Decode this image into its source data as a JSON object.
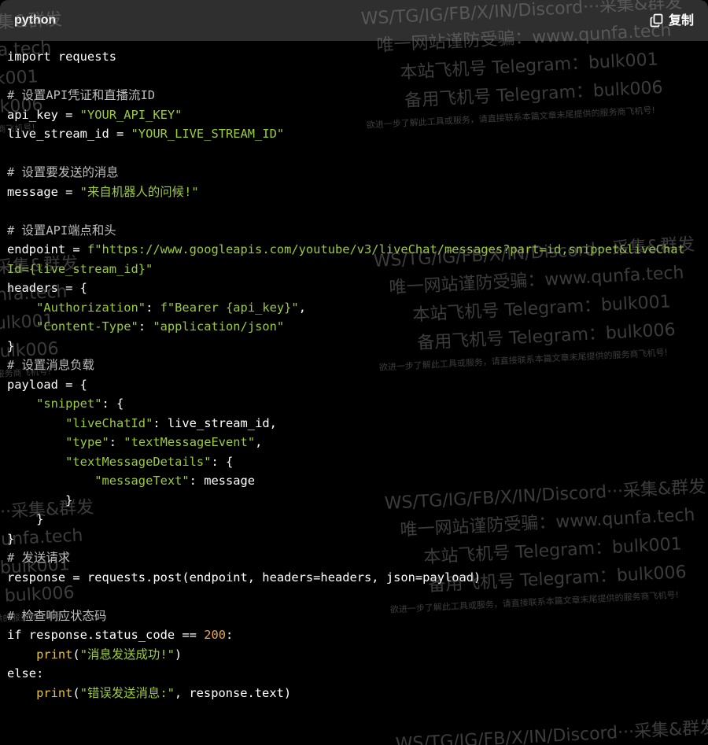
{
  "header": {
    "language": "python",
    "copy_label": "复制",
    "copy_icon": "copy-icon"
  },
  "code_lines": [
    [
      {
        "t": "import requests",
        "c": "kw"
      }
    ],
    [],
    [
      {
        "t": "# 设置API凭证和直播流ID",
        "c": "cm"
      }
    ],
    [
      {
        "t": "api_key = ",
        "c": "kw"
      },
      {
        "t": "\"YOUR_API_KEY\"",
        "c": "st"
      }
    ],
    [
      {
        "t": "live_stream_id = ",
        "c": "kw"
      },
      {
        "t": "\"YOUR_LIVE_STREAM_ID\"",
        "c": "st"
      }
    ],
    [],
    [
      {
        "t": "# 设置要发送的消息",
        "c": "cm"
      }
    ],
    [
      {
        "t": "message = ",
        "c": "kw"
      },
      {
        "t": "\"来自机器人的问候!\"",
        "c": "st"
      }
    ],
    [],
    [
      {
        "t": "# 设置API端点和头",
        "c": "cm"
      }
    ],
    [
      {
        "t": "endpoint = ",
        "c": "kw"
      },
      {
        "t": "f\"https://www.googleapis.com/youtube/v3/liveChat/messages?part=id,snippet&liveChat",
        "c": "st"
      }
    ],
    [
      {
        "t": "Id={live_stream_id}\"",
        "c": "st"
      }
    ],
    [
      {
        "t": "headers = {",
        "c": "kw"
      }
    ],
    [
      {
        "t": "    ",
        "c": "kw"
      },
      {
        "t": "\"Authorization\"",
        "c": "st"
      },
      {
        "t": ": ",
        "c": "kw"
      },
      {
        "t": "f\"Bearer {api_key}\"",
        "c": "st"
      },
      {
        "t": ",",
        "c": "kw"
      }
    ],
    [
      {
        "t": "    ",
        "c": "kw"
      },
      {
        "t": "\"Content-Type\"",
        "c": "st"
      },
      {
        "t": ": ",
        "c": "kw"
      },
      {
        "t": "\"application/json\"",
        "c": "st"
      }
    ],
    [
      {
        "t": "}",
        "c": "kw"
      }
    ],
    [
      {
        "t": "# 设置消息负载",
        "c": "cm"
      }
    ],
    [
      {
        "t": "payload = {",
        "c": "kw"
      }
    ],
    [
      {
        "t": "    ",
        "c": "kw"
      },
      {
        "t": "\"snippet\"",
        "c": "st"
      },
      {
        "t": ": {",
        "c": "kw"
      }
    ],
    [
      {
        "t": "        ",
        "c": "kw"
      },
      {
        "t": "\"liveChatId\"",
        "c": "st"
      },
      {
        "t": ": live_stream_id,",
        "c": "kw"
      }
    ],
    [
      {
        "t": "        ",
        "c": "kw"
      },
      {
        "t": "\"type\"",
        "c": "st"
      },
      {
        "t": ": ",
        "c": "kw"
      },
      {
        "t": "\"textMessageEvent\"",
        "c": "st"
      },
      {
        "t": ",",
        "c": "kw"
      }
    ],
    [
      {
        "t": "        ",
        "c": "kw"
      },
      {
        "t": "\"textMessageDetails\"",
        "c": "st"
      },
      {
        "t": ": {",
        "c": "kw"
      }
    ],
    [
      {
        "t": "            ",
        "c": "kw"
      },
      {
        "t": "\"messageText\"",
        "c": "st"
      },
      {
        "t": ": message",
        "c": "kw"
      }
    ],
    [
      {
        "t": "        }",
        "c": "kw"
      }
    ],
    [
      {
        "t": "    }",
        "c": "kw"
      }
    ],
    [
      {
        "t": "}",
        "c": "kw"
      }
    ],
    [
      {
        "t": "# 发送请求",
        "c": "cm"
      }
    ],
    [
      {
        "t": "response = requests.post(endpoint, headers=headers, json=payload)",
        "c": "kw"
      }
    ],
    [],
    [
      {
        "t": "# 检查响应状态码",
        "c": "cm"
      }
    ],
    [
      {
        "t": "if response.status_code == ",
        "c": "kw"
      },
      {
        "t": "200",
        "c": "nm"
      },
      {
        "t": ":",
        "c": "kw"
      }
    ],
    [
      {
        "t": "    ",
        "c": "kw"
      },
      {
        "t": "print",
        "c": "bi"
      },
      {
        "t": "(",
        "c": "kw"
      },
      {
        "t": "\"消息发送成功!\"",
        "c": "st"
      },
      {
        "t": ")",
        "c": "kw"
      }
    ],
    [
      {
        "t": "else:",
        "c": "kw"
      }
    ],
    [
      {
        "t": "    ",
        "c": "kw"
      },
      {
        "t": "print",
        "c": "bi"
      },
      {
        "t": "(",
        "c": "kw"
      },
      {
        "t": "\"错误发送消息:\"",
        "c": "st"
      },
      {
        "t": ", response.text)",
        "c": "kw"
      }
    ]
  ],
  "watermark": {
    "line1": "WS/TG/IG/FB/X/IN/Discord···采集&群发",
    "line2": "唯一网站谨防受骗：www.qunfa.tech",
    "line3": "本站飞机号 Telegram：bulk001",
    "line4": "备用飞机号 Telegram：bulk006",
    "line5": "欲进一步了解此工具或服务，请直接联系本篇文章末尾提供的服务商飞机号!"
  },
  "colors": {
    "background": "#000000",
    "header_bg": "#2f2f2f",
    "comment": "#bdbdbd",
    "string": "#9ccc37",
    "number": "#e6a64b",
    "builtin": "#e6c440"
  }
}
